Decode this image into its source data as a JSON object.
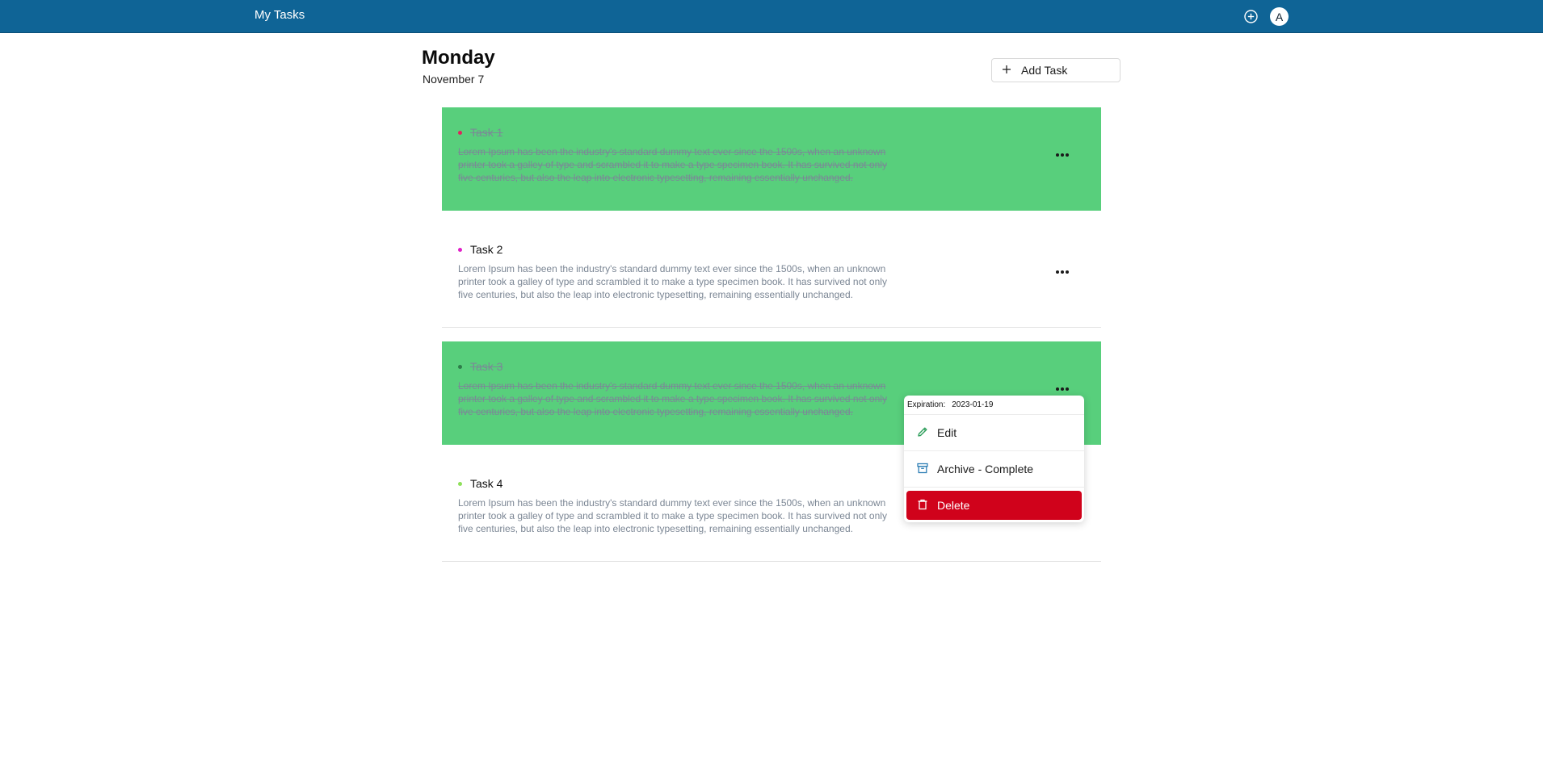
{
  "header": {
    "app_title": "My Tasks",
    "add_icon": "plus-circle-icon",
    "avatar_initial": "A"
  },
  "page": {
    "day": "Monday",
    "date": "November 7",
    "add_task_label": "Add Task"
  },
  "colors": {
    "topbar": "#0f6496",
    "completed_bg": "#58cf7c",
    "danger": "#d0021b"
  },
  "tasks": [
    {
      "title": "Task 1",
      "status": "completed",
      "dot_color": "#e0245e",
      "description": "Lorem Ipsum has been the industry's standard dummy text ever since the 1500s, when an unknown printer took a galley of type and scrambled it to make a type specimen book. It has survived not only five centuries, but also the leap into electronic typesetting, remaining essentially unchanged."
    },
    {
      "title": "Task 2",
      "status": "open",
      "dot_color": "#e020c8",
      "description": "Lorem Ipsum has been the industry's standard dummy text ever since the 1500s, when an unknown printer took a galley of type and scrambled it to make a type specimen book. It has survived not only five centuries, but also the leap into electronic typesetting, remaining essentially unchanged."
    },
    {
      "title": "Task 3",
      "status": "completed",
      "dot_color": "#2e7d4a",
      "description": "Lorem Ipsum has been the industry's standard dummy text ever since the 1500s, when an unknown printer took a galley of type and scrambled it to make a type specimen book. It has survived not only five centuries, but also the leap into electronic typesetting, remaining essentially unchanged."
    },
    {
      "title": "Task 4",
      "status": "open",
      "dot_color": "#8ee05a",
      "description": "Lorem Ipsum has been the industry's standard dummy text ever since the 1500s, when an unknown printer took a galley of type and scrambled it to make a type specimen book. It has survived not only five centuries, but also the leap into electronic typesetting, remaining essentially unchanged."
    }
  ],
  "context_menu": {
    "expiration_label": "Expiration:",
    "expiration_value": "2023-01-19",
    "items": [
      {
        "label": "Edit",
        "icon": "pencil-icon"
      },
      {
        "label": "Archive - Complete",
        "icon": "archive-icon"
      },
      {
        "label": "Delete",
        "icon": "trash-icon"
      }
    ]
  }
}
